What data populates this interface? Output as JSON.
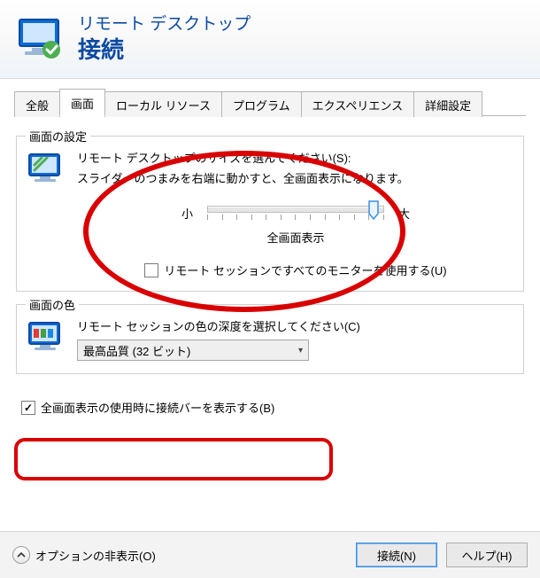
{
  "header": {
    "line1": "リモート デスクトップ",
    "line2": "接続"
  },
  "tabs": [
    {
      "label": "全般"
    },
    {
      "label": "画面"
    },
    {
      "label": "ローカル リソース"
    },
    {
      "label": "プログラム"
    },
    {
      "label": "エクスペリエンス"
    },
    {
      "label": "詳細設定"
    }
  ],
  "active_tab_index": 1,
  "group_display": {
    "title": "画面の設定",
    "desc1": "リモート デスクトップのサイズを選んでください(S):",
    "desc2": "スライダーのつまみを右端に動かすと、全画面表示になります。",
    "slider": {
      "small": "小",
      "large": "大",
      "value_label": "全画面表示"
    },
    "multimon_label": "リモート セッションですべてのモニターを使用する(U)",
    "multimon_checked": false
  },
  "group_color": {
    "title": "画面の色",
    "desc": "リモート セッションの色の深度を選択してください(C)",
    "selected": "最高品質 (32 ビット)"
  },
  "connbar": {
    "label": "全画面表示の使用時に接続バーを表示する(B)",
    "checked": true
  },
  "footer": {
    "options": "オプションの非表示(O)",
    "connect": "接続(N)",
    "help": "ヘルプ(H)"
  },
  "colors": {
    "accent": "#0a4aa1",
    "annotation": "#d90000"
  }
}
